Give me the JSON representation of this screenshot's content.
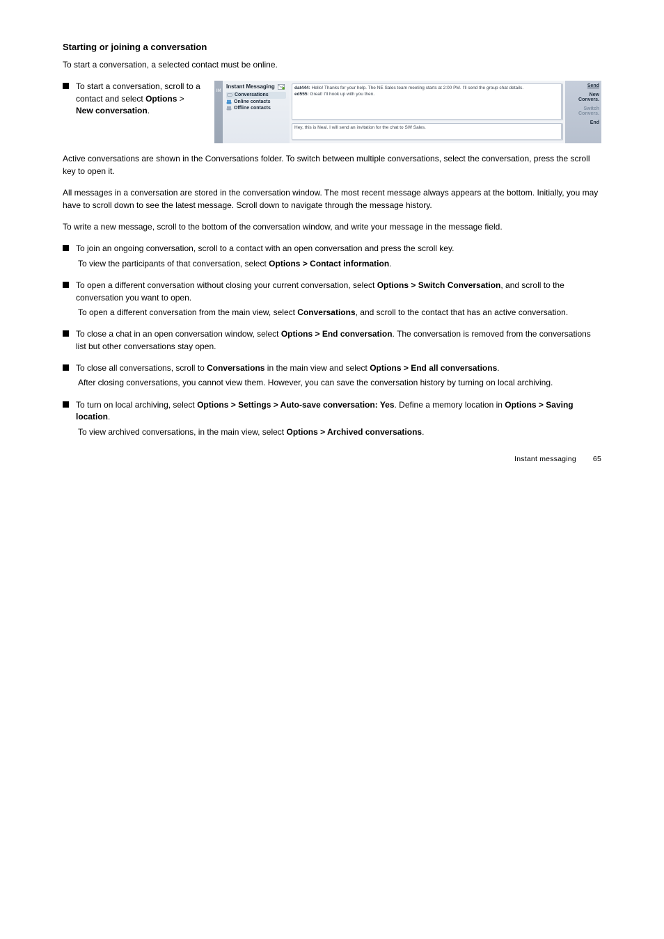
{
  "page": {
    "heading": "Starting or joining a conversation",
    "intro_p1": "To start a conversation, a selected contact must be online.",
    "bullet_start_conv": "To start a conversation, scroll to a contact and select",
    "start_path": "Options",
    "start_gt": " > ",
    "start_new": "New conversation",
    "start_after": "."
  },
  "im": {
    "title": "Instant Messaging",
    "tree_conversations": "Conversations",
    "tree_online": "Online contacts",
    "tree_offline": "Offline contacts",
    "rail_top": " ",
    "rail_im": "IM",
    "line1_user": "dat444:",
    "line1_rest": " Hello! Thanks for your help. The NE Sales team meeting starts at 2:00 PM. I'll send the group chat details.",
    "line2_user": "ed555:",
    "line2_rest": " Great! I'll hook up with you then.",
    "input_value": "Hey, this is Neal. I will send an invitation for the chat to SW Sales.",
    "send": "Send",
    "new_convers": "New Convers.",
    "switch": "Switch Convers.",
    "end": "End"
  },
  "mid": {
    "p_active": "Active conversations are shown in the Conversations folder. To switch between multiple conversations, select the conversation, press the scroll key to open it.",
    "p_msg_history": "All messages in a conversation are stored in the conversation window. The most recent message always appears at the bottom. Initially, you may have to scroll down to see the latest message. Scroll down to navigate through the message history.",
    "p_write": "To write a new message, scroll to the bottom of the conversation window, and write your message in the message field."
  },
  "bullets": {
    "b2": "To join an ongoing conversation, scroll to a contact with an open conversation and press the scroll key.",
    "b2_sub": "To view the participants of that conversation, select ",
    "b2_sub_b": "Options > Contact information",
    "b2_sub_after": ".",
    "b3_pre": "To open a different conversation without closing your current conversation, select ",
    "b3_b": "Options > Switch Conversation",
    "b3_after": ", and scroll to the conversation you want to open.",
    "b3_sub": "To open a different conversation from the main view, select ",
    "b3_sub_b": "Conversations",
    "b3_sub_after": ", and scroll to the contact that has an active conversation.",
    "b4": "To close a chat in an open conversation window, select ",
    "b4_b": "Options > End conversation",
    "b4_after": ". The conversation is removed from the conversations list but other conversations stay open.",
    "b5": "To close all conversations, scroll to ",
    "b5_b": "Conversations",
    "b5_mid": " in the main view and select ",
    "b5_b2": "Options > End all conversations",
    "b5_after": ".",
    "after_b5_p": "After closing conversations, you cannot view them. However, you can save the conversation history by turning on local archiving.",
    "b6": "To turn on local archiving, select ",
    "b6_b": "Options > Settings > Auto-save conversation: Yes",
    "b6_mid": ". Define a memory location in ",
    "b6_b2": "Options > Saving location",
    "b6_after": ".",
    "b6_sub": "To view archived conversations, in the main view, select ",
    "b6_sub_b": "Options > Archived conversations",
    "b6_sub_after": "."
  },
  "footer": {
    "section": "Instant messaging",
    "page": "65"
  }
}
